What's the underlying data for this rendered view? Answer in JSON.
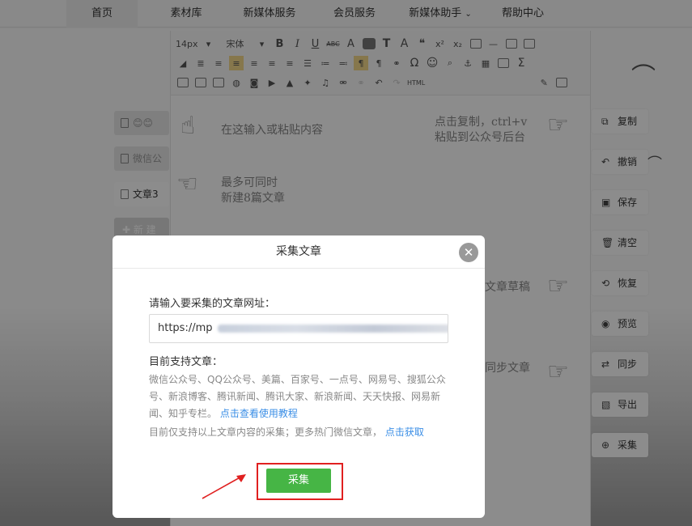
{
  "nav": {
    "items": [
      {
        "label": "首页"
      },
      {
        "label": "素材库"
      },
      {
        "label": "新媒体服务"
      },
      {
        "label": "会员服务"
      },
      {
        "label": "新媒体助手"
      },
      {
        "label": "帮助中心"
      }
    ],
    "dropdown_chevron": "⌄"
  },
  "left_tabs": {
    "tab1": "😊😊",
    "tab2": "微信公",
    "tab3": "文章3",
    "new": "✚ 新 建"
  },
  "toolbar": {
    "font_size": "14px",
    "font_family": "宋体",
    "bold": "B",
    "italic": "I",
    "underline": "U",
    "strike": "ABC",
    "font_color": "A",
    "text_icon": "T",
    "highlight_A": "A",
    "quote": "❝",
    "superscript": "x²",
    "subscript": "x₂",
    "omega": "Ω",
    "sigma": "Σ",
    "html": "HTML",
    "smiley": "☺"
  },
  "editor": {
    "hint1": "在这输入或粘贴内容",
    "hint2_line1": "点击复制，ctrl+v",
    "hint2_line2": "粘贴到公众号后台",
    "hint3_line1": "最多可同时",
    "hint3_line2": "新建8篇文章",
    "hint4": "文章草稿",
    "hint5": "同步文章"
  },
  "right_actions": [
    {
      "icon": "⧉",
      "label": "复制"
    },
    {
      "icon": "↶",
      "label": "撤销"
    },
    {
      "icon": "▣",
      "label": "保存"
    },
    {
      "icon": "🗑",
      "label": "清空"
    },
    {
      "icon": "⟲",
      "label": "恢复"
    },
    {
      "icon": "◉",
      "label": "预览"
    },
    {
      "icon": "⇄",
      "label": "同步"
    },
    {
      "icon": "▧",
      "label": "导出"
    },
    {
      "icon": "⊕",
      "label": "采集"
    }
  ],
  "modal": {
    "title": "采集文章",
    "close": "✕",
    "url_label": "请输入要采集的文章网址：",
    "url_value": "https://mp",
    "support_title": "目前支持文章：",
    "support_list": "微信公众号、QQ公众号、美篇、百家号、一点号、网易号、搜狐公众号、新浪博客、腾讯新闻、腾讯大家、新浪新闻、天天快报、网易新闻、知乎专栏。",
    "support_link": "点击查看使用教程",
    "note": "目前仅支持以上文章内容的采集；更多热门微信文章，",
    "note_link": "点击获取",
    "submit": "采集"
  },
  "colors": {
    "accent_green": "#46b545",
    "link_blue": "#3a8ee6",
    "annotation_red": "#e02020"
  }
}
